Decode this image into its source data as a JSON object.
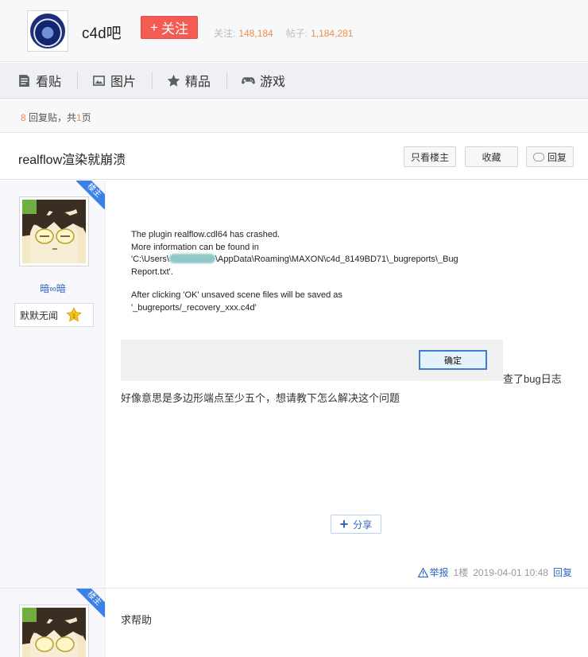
{
  "forum": {
    "name": "c4d吧",
    "follow_label": "关注",
    "follow_count_label": "关注:",
    "follow_count": "148,184",
    "post_count_label": "帖子:",
    "post_count": "1,184,281"
  },
  "nav": {
    "items": [
      {
        "label": "看贴",
        "icon": "document-icon"
      },
      {
        "label": "图片",
        "icon": "image-icon"
      },
      {
        "label": "精品",
        "icon": "star-icon"
      },
      {
        "label": "游戏",
        "icon": "gamepad-icon"
      }
    ]
  },
  "reply_info": {
    "count": "8",
    "count_suffix": " 回复贴，共",
    "pages": "1",
    "pages_suffix": "页"
  },
  "thread": {
    "title": "realflow渲染就崩溃",
    "only_op_label": "只看楼主",
    "favorite_label": "收藏",
    "reply_label": "回复"
  },
  "posts": [
    {
      "badge": "楼主",
      "username": "暗∞暗",
      "level_title": "默默无闻",
      "level_num": "1",
      "crash_dialog": {
        "line1": "The plugin realflow.cdl64 has crashed.",
        "line2": "More information can be found in",
        "line3_pre": "'C:\\Users\\",
        "line3_post": "\\AppData\\Roaming\\MAXON\\c4d_8149BD71\\_bugreports\\_Bug",
        "line4": "Report.txt'.",
        "line5": "After clicking 'OK' unsaved scene files will be saved as",
        "line6": "'_bugreports/_recovery_xxx.c4d'",
        "ok_label": "确定"
      },
      "bug_note": "查了bug日志",
      "body": "好像意思是多边形端点至少五个，想请教下怎么解决这个问题",
      "share_label": "分享",
      "report_label": "举报",
      "floor": "1楼",
      "timestamp": "2019-04-01 10:48",
      "reply_label": "回复"
    },
    {
      "badge": "楼主",
      "body": "求帮助"
    }
  ],
  "colors": {
    "accent_blue": "#2f65c1",
    "follow_red": "#f35b53",
    "count_orange": "#f08d4b"
  }
}
